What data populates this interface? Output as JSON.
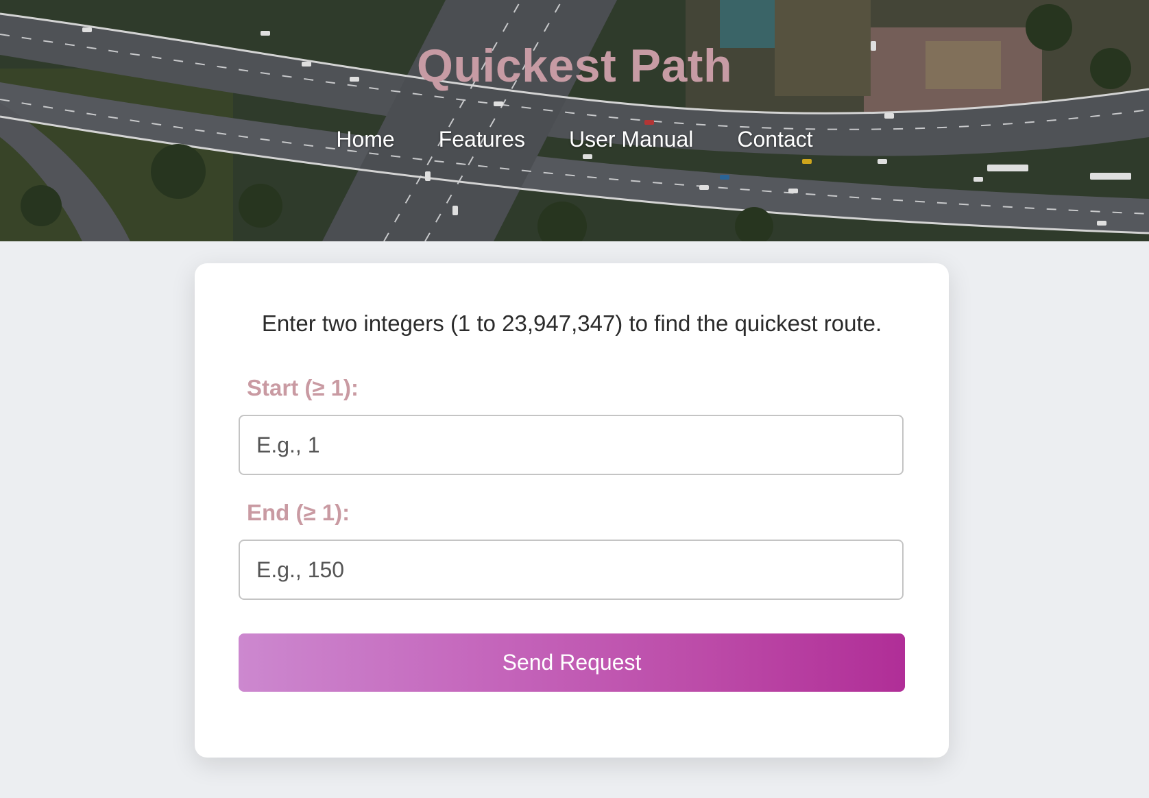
{
  "header": {
    "title": "Quickest Path",
    "nav": [
      {
        "label": "Home"
      },
      {
        "label": "Features"
      },
      {
        "label": "User Manual"
      },
      {
        "label": "Contact"
      }
    ]
  },
  "form": {
    "intro": "Enter two integers (1 to 23,947,347) to find the quickest route.",
    "start": {
      "label": "Start (≥ 1):",
      "placeholder": "E.g., 1",
      "value": ""
    },
    "end": {
      "label": "End (≥ 1):",
      "placeholder": "E.g., 150",
      "value": ""
    },
    "submit_label": "Send Request"
  },
  "colors": {
    "title": "#c79ba4",
    "label": "#c99aa2",
    "button_gradient_start": "#cc88cf",
    "button_gradient_end": "#b02e97",
    "page_background": "#eceef1"
  }
}
